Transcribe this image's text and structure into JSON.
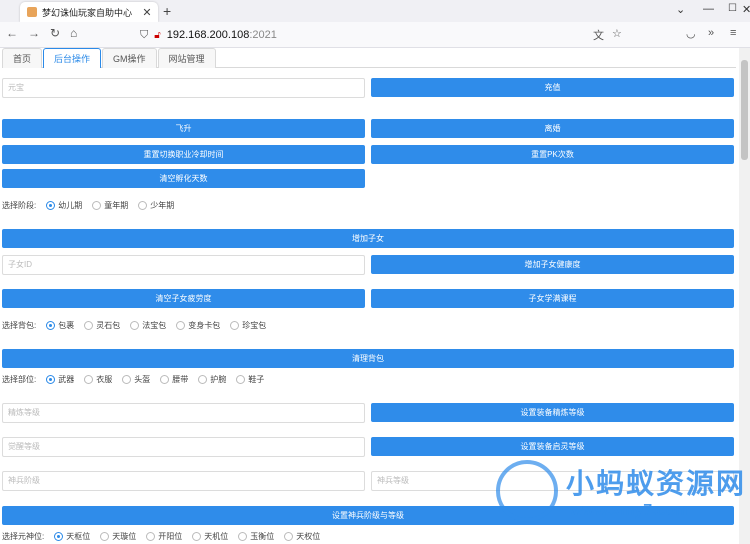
{
  "browser": {
    "tab_title": "梦幻诛仙玩家自助中心",
    "url_host": "192.168.200.108",
    "url_port": ":2021"
  },
  "page_tabs": [
    "首页",
    "后台操作",
    "GM操作",
    "网站管理"
  ],
  "fields": {
    "role": "元宝",
    "child_id": "子女ID",
    "equip_refine": "精炼等级",
    "equip_awaken": "觉醒等级",
    "weapon_stage": "神兵阶级",
    "weapon_level": "神兵等级"
  },
  "buttons": {
    "recharge": "充值",
    "ascend": "飞升",
    "divorce": "离婚",
    "reset_job_cd": "重置切换职业冷却时间",
    "reset_pk": "重置PK次数",
    "clear_incubate": "清空孵化天数",
    "add_child": "增加子女",
    "add_child_health": "增加子女健康度",
    "clear_child_fatigue": "清空子女疲劳度",
    "child_study": "子女学满课程",
    "clear_bag": "清理背包",
    "set_refine": "设置装备精炼等级",
    "set_awaken": "设置装备启灵等级",
    "set_weapon": "设置神兵阶级与等级"
  },
  "stage": {
    "label": "选择阶段:",
    "options": [
      "幼儿期",
      "童年期",
      "少年期"
    ]
  },
  "bag": {
    "label": "选择背包:",
    "options": [
      "包裹",
      "灵石包",
      "法宝包",
      "变身卡包",
      "珍宝包"
    ]
  },
  "part": {
    "label": "选择部位:",
    "options": [
      "武器",
      "衣服",
      "头盔",
      "腰带",
      "护腕",
      "鞋子"
    ]
  },
  "spirit": {
    "label": "选择元神位:",
    "options": [
      "天枢位",
      "天璇位",
      "开阳位",
      "天机位",
      "玉衡位",
      "天权位"
    ]
  },
  "watermark": {
    "title": "小蚂蚁资源网",
    "url": "www.xmy7.com"
  }
}
